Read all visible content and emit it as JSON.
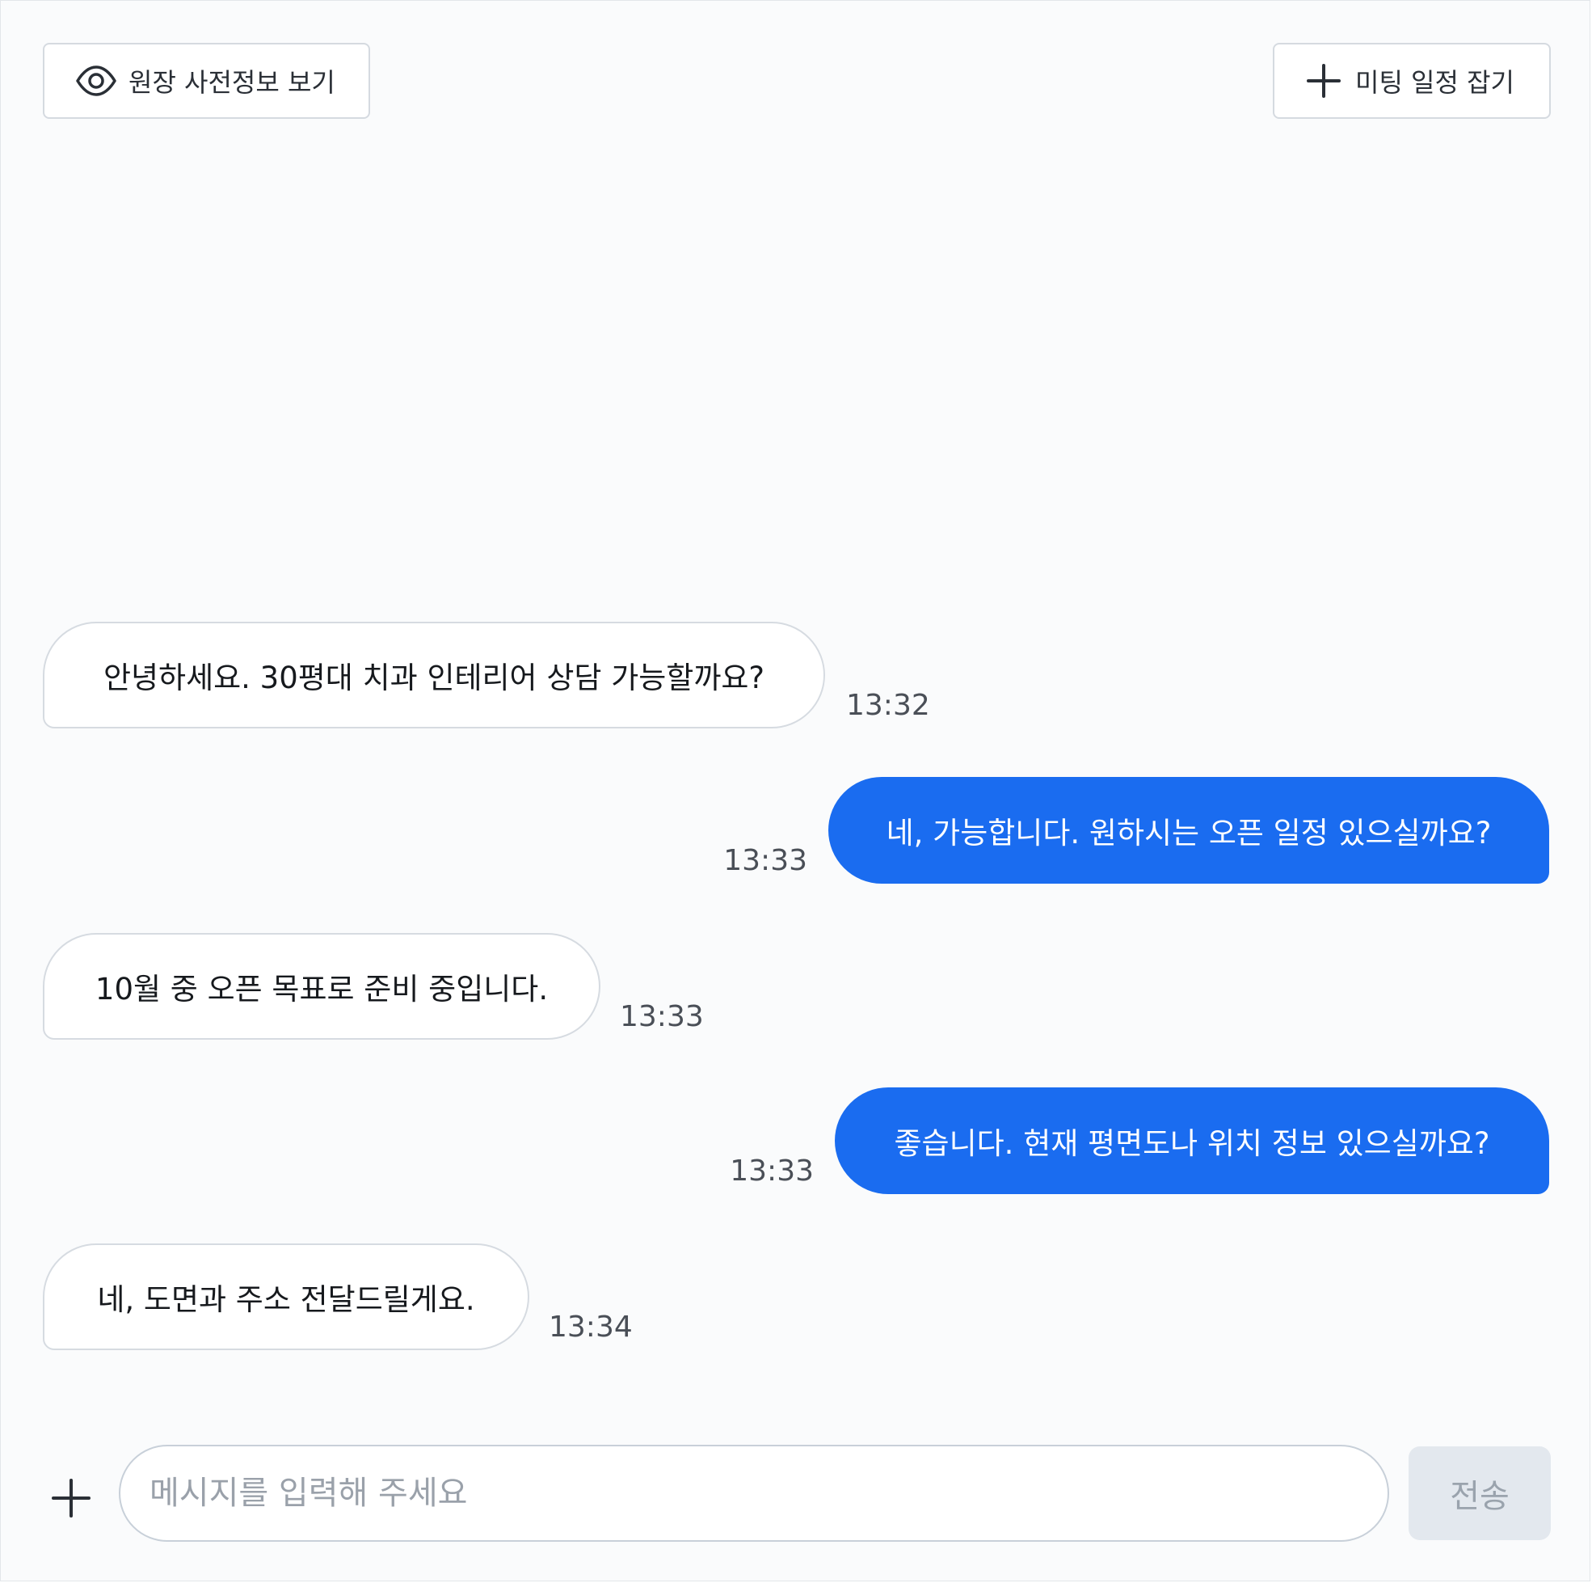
{
  "header": {
    "view_button": {
      "label": "원장 사전정보 보기",
      "icon": "eye-icon"
    },
    "meeting_button": {
      "label": "미팅 일정 잡기",
      "icon": "plus-icon"
    }
  },
  "messages": [
    {
      "direction": "incoming",
      "text": "안녕하세요. 30평대 치과 인테리어 상담 가능할까요?",
      "time": "13:32"
    },
    {
      "direction": "outgoing",
      "text": "네, 가능합니다. 원하시는 오픈 일정 있으실까요?",
      "time": "13:33"
    },
    {
      "direction": "incoming",
      "text": "10월 중 오픈 목표로 준비 중입니다.",
      "time": "13:33"
    },
    {
      "direction": "outgoing",
      "text": "좋습니다. 현재 평면도나 위치 정보 있으실까요?",
      "time": "13:33"
    },
    {
      "direction": "incoming",
      "text": "네, 도면과 주소 전달드릴게요.",
      "time": "13:34"
    }
  ],
  "composer": {
    "placeholder": "메시지를 입력해 주세요",
    "value": "",
    "send_label": "전송",
    "attach_icon": "plus-icon"
  },
  "colors": {
    "accent": "#1a6cf0",
    "background": "#fafbfc",
    "send_disabled": "#e3e8ee"
  }
}
